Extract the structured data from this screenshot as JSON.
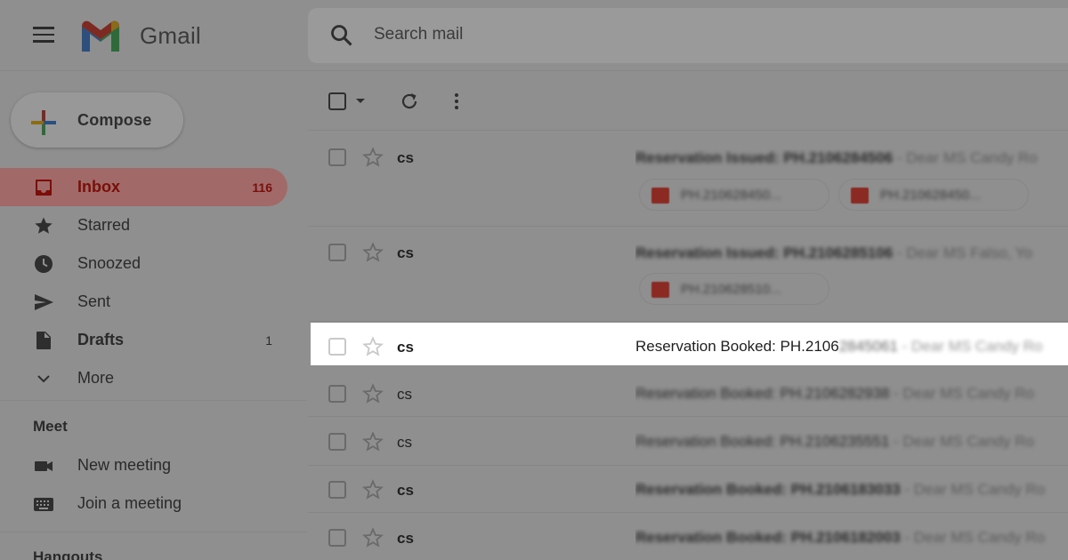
{
  "header": {
    "app_name": "Gmail",
    "search_placeholder": "Search mail"
  },
  "sidebar": {
    "compose_label": "Compose",
    "items": [
      {
        "label": "Inbox",
        "count": "116",
        "icon": "inbox-icon",
        "active": true
      },
      {
        "label": "Starred",
        "count": "",
        "icon": "star-icon"
      },
      {
        "label": "Snoozed",
        "count": "",
        "icon": "clock-icon"
      },
      {
        "label": "Sent",
        "count": "",
        "icon": "send-icon"
      },
      {
        "label": "Drafts",
        "count": "1",
        "icon": "draft-icon"
      },
      {
        "label": "More",
        "count": "",
        "icon": "chevron-down-icon"
      }
    ],
    "meet": {
      "title": "Meet",
      "items": [
        {
          "label": "New meeting",
          "icon": "video-icon"
        },
        {
          "label": "Join a meeting",
          "icon": "keyboard-icon"
        }
      ]
    },
    "hangouts_title": "Hangouts"
  },
  "emails": [
    {
      "sender": "cs",
      "subject": "Reservation Issued: PH.2106284506",
      "snippet": " - Dear MS Candy Ro",
      "attachments": [
        "PH.210628450...",
        "PH.210628450..."
      ]
    },
    {
      "sender": "cs",
      "subject": "Reservation Issued: PH.2106285106",
      "snippet": " - Dear MS Falso, Yo",
      "attachments": [
        "PH.210628510..."
      ]
    },
    {
      "sender": "cs",
      "subject_visible": "Reservation Booked: PH.2106",
      "subject_blurred": "2845061",
      "snippet": " - Dear MS Candy Ro",
      "highlighted": true
    },
    {
      "sender": "cs",
      "subject": "Reservation Booked: PH.2106282938",
      "snippet": " - Dear MS Candy Ro"
    },
    {
      "sender": "cs",
      "subject": "Reservation Booked: PH.2106235551",
      "snippet": " - Dear MS Candy Ro"
    },
    {
      "sender": "cs",
      "subject": "Reservation Booked: PH.2106183033",
      "snippet": " - Dear MS Candy Ro"
    },
    {
      "sender": "cs",
      "subject": "Reservation Booked: PH.2106182003",
      "snippet": " - Dear MS Candy Ro"
    }
  ],
  "colors": {
    "overlay": "#8f8f8f",
    "highlight_row": "#ffffff",
    "inbox_active": "#7a0f0a"
  }
}
